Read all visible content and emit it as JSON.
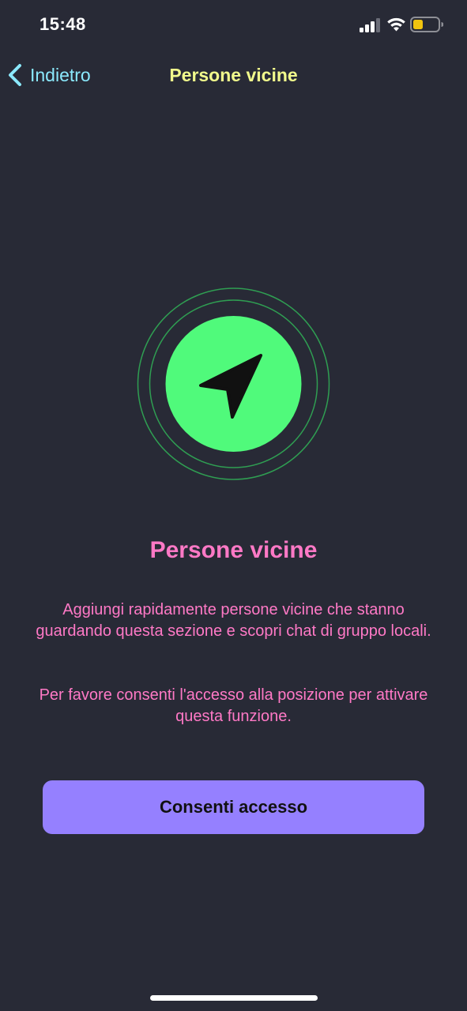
{
  "status_bar": {
    "time": "15:48"
  },
  "nav": {
    "back_label": "Indietro",
    "title": "Persone vicine"
  },
  "content": {
    "title": "Persone vicine",
    "description": "Aggiungi rapidamente persone vicine che stanno guardando questa sezione e scopri chat di gruppo locali.",
    "permission_note": "Per favore consenti l'accesso alla posizione per attivare questa funzione."
  },
  "actions": {
    "allow_label": "Consenti accesso"
  },
  "icons": {
    "hero": "location-arrow-icon",
    "back": "chevron-left-icon",
    "signal": "cellular-signal-icon",
    "wifi": "wifi-icon",
    "battery": "battery-icon"
  },
  "colors": {
    "background": "#282a36",
    "accent_cyan": "#8be9fd",
    "title_yellow": "#f1fa8c",
    "text_pink": "#ff79c6",
    "hero_green": "#50fa7b",
    "button_purple": "#9580ff",
    "battery_yellow": "#f1c40f"
  }
}
